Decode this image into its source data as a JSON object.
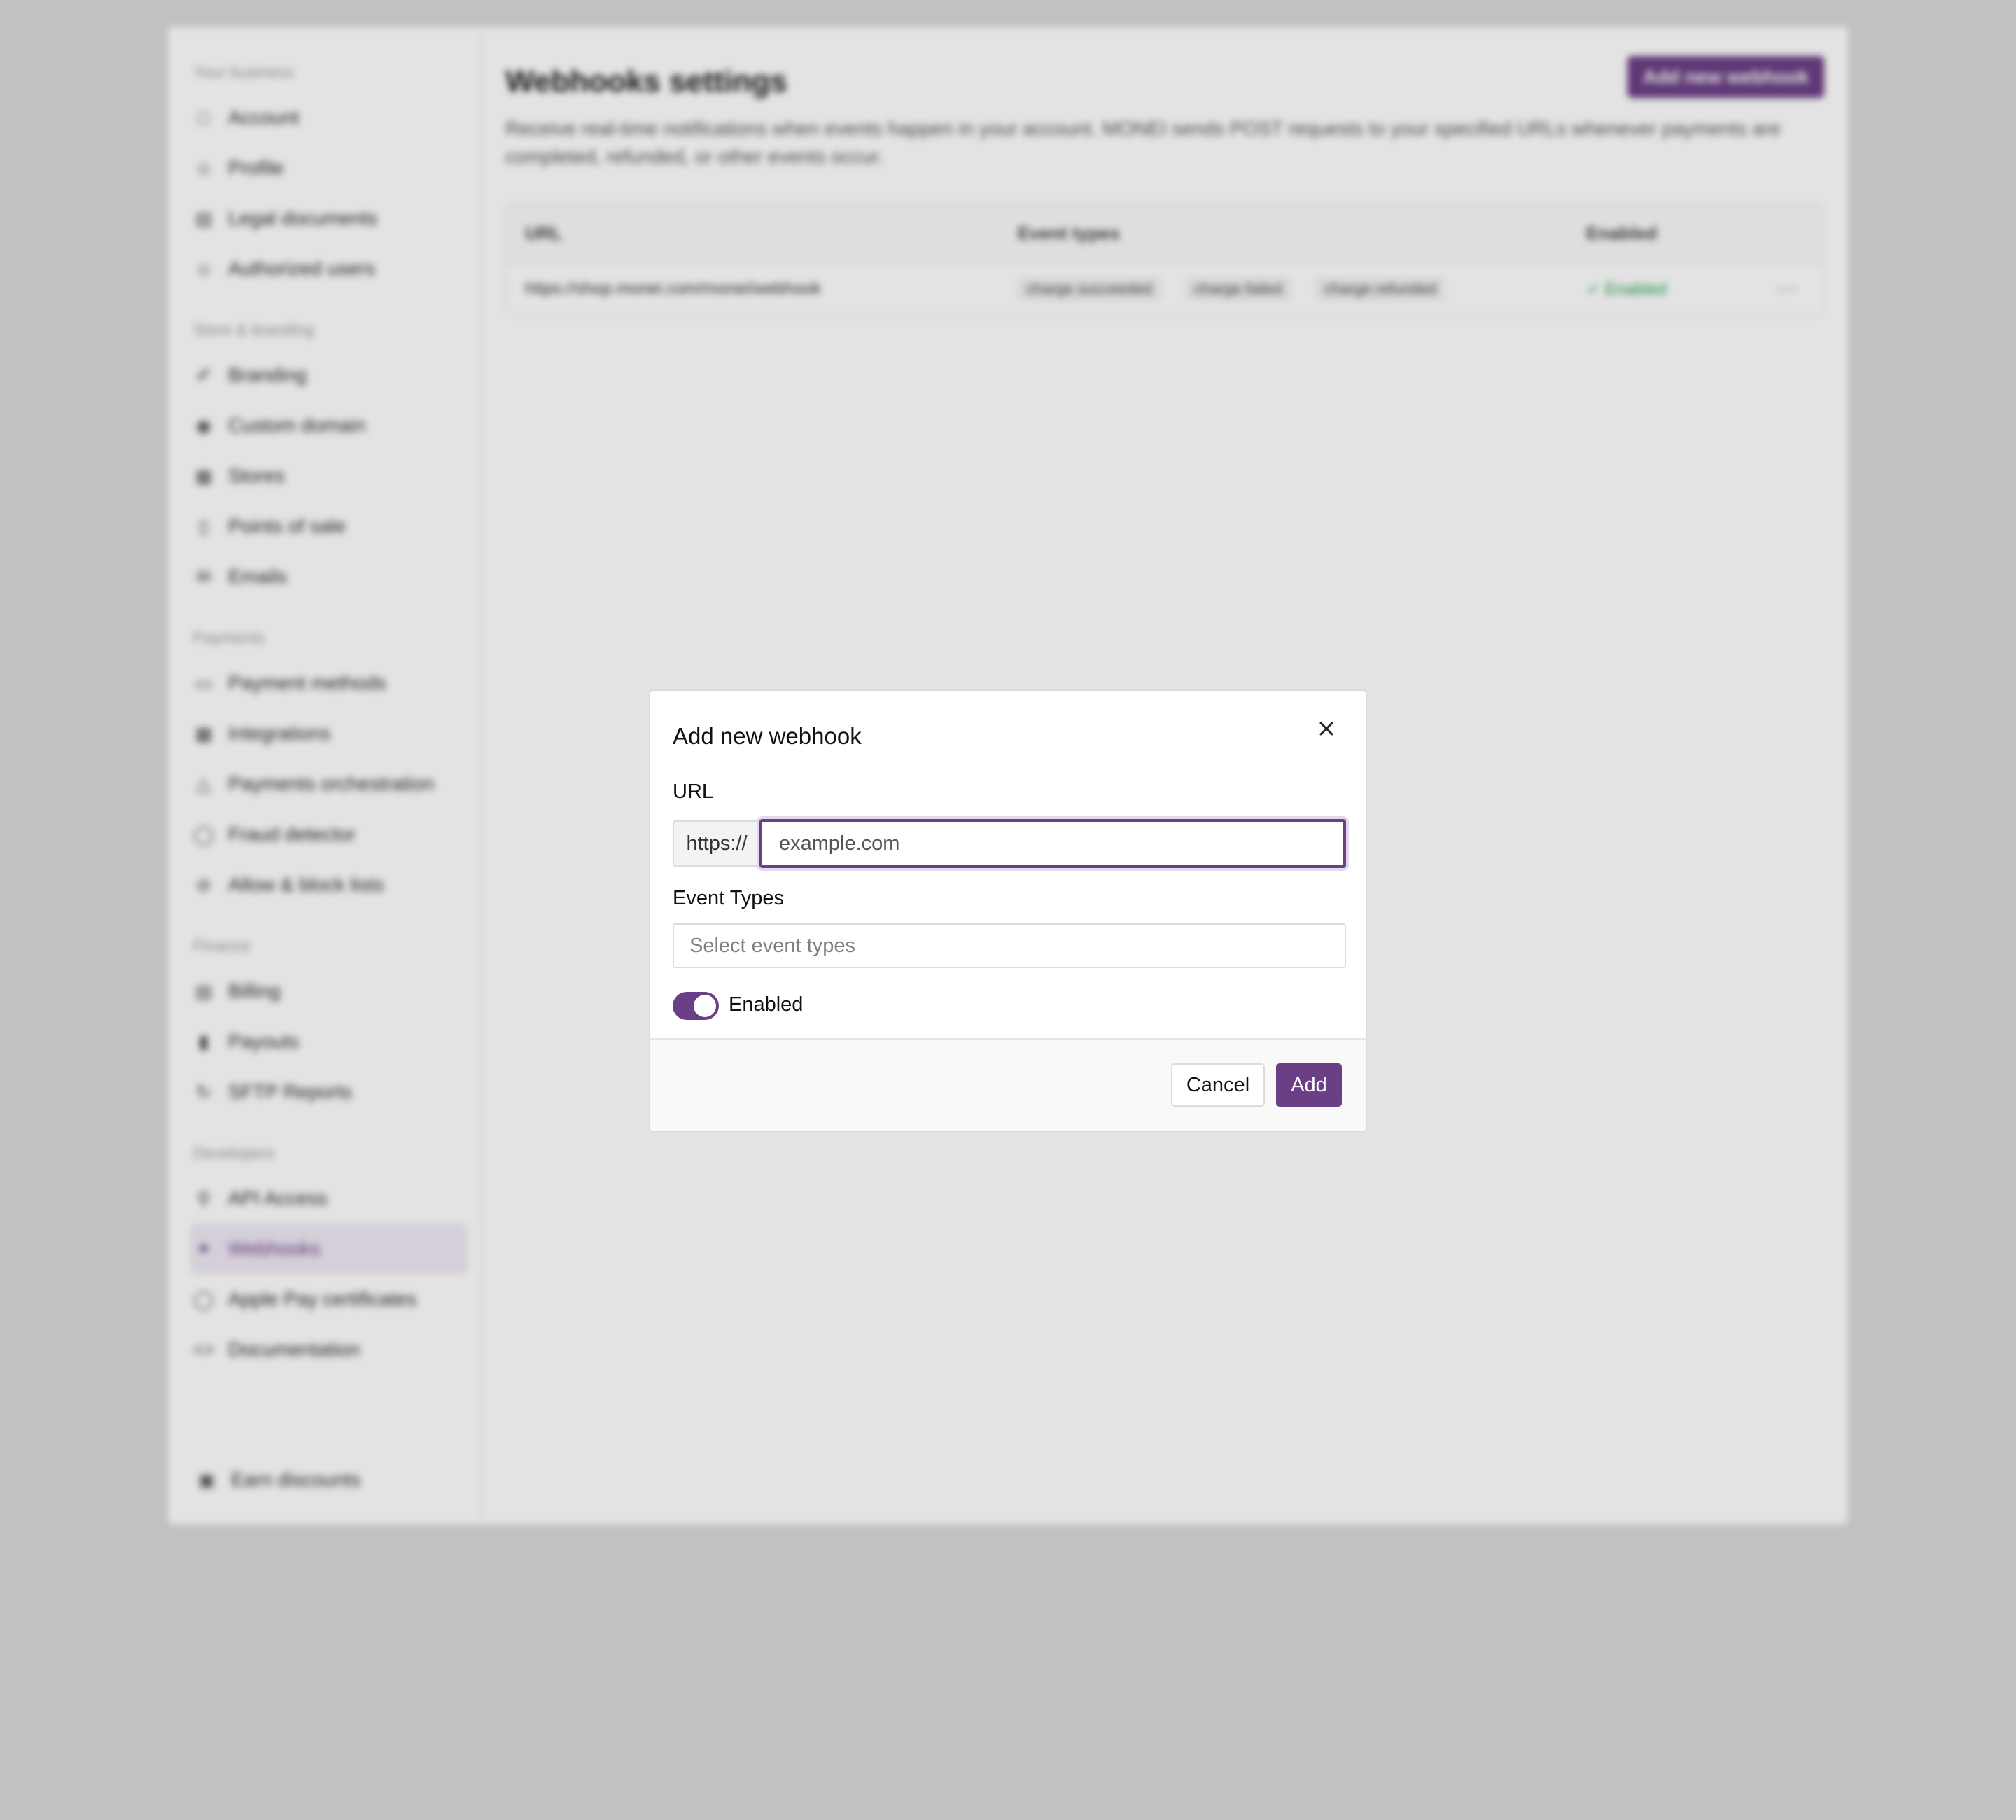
{
  "background": {
    "sidebar": {
      "sections": [
        {
          "heading": "Your business",
          "items": [
            {
              "label": "Account",
              "icon": "building-icon"
            },
            {
              "label": "Profile",
              "icon": "user-icon"
            },
            {
              "label": "Legal documents",
              "icon": "document-icon"
            },
            {
              "label": "Authorized users",
              "icon": "users-icon"
            }
          ]
        },
        {
          "heading": "Store & branding",
          "items": [
            {
              "label": "Branding",
              "icon": "brush-icon"
            },
            {
              "label": "Custom domain",
              "icon": "globe-icon"
            },
            {
              "label": "Stores",
              "icon": "store-icon"
            },
            {
              "label": "Points of sale",
              "icon": "device-icon"
            },
            {
              "label": "Emails",
              "icon": "mail-icon"
            }
          ]
        },
        {
          "heading": "Payments",
          "items": [
            {
              "label": "Payment methods",
              "icon": "card-icon"
            },
            {
              "label": "Integrations",
              "icon": "puzzle-icon"
            },
            {
              "label": "Payments orchestration",
              "icon": "route-icon"
            },
            {
              "label": "Fraud detector",
              "icon": "shield-icon"
            },
            {
              "label": "Allow & block lists",
              "icon": "list-icon"
            }
          ]
        },
        {
          "heading": "Finance",
          "items": [
            {
              "label": "Billing",
              "icon": "receipt-icon"
            },
            {
              "label": "Payouts",
              "icon": "payout-icon"
            },
            {
              "label": "SFTP Reports",
              "icon": "report-icon"
            }
          ]
        },
        {
          "heading": "Developers",
          "items": [
            {
              "label": "API Access",
              "icon": "key-icon"
            },
            {
              "label": "Webhooks",
              "icon": "webhook-icon"
            },
            {
              "label": "Apple Pay certificates",
              "icon": "apple-icon"
            },
            {
              "label": "Documentation",
              "icon": "code-icon"
            }
          ]
        }
      ],
      "active_item": "Webhooks",
      "bottom_item": {
        "label": "Earn discounts",
        "icon": "gift-icon"
      }
    },
    "main": {
      "title": "Webhooks settings",
      "add_button": "Add new webhook",
      "description": "Receive real-time notifications when events happen in your account. MONEI sends POST requests to your specified URLs whenever payments are completed, refunded, or other events occur.",
      "table": {
        "headers": [
          "URL",
          "Event types",
          "Enabled"
        ],
        "rows": [
          {
            "url": "https://shop.monei.com/monei/webhook",
            "events": [
              "charge.succeeded",
              "charge.failed",
              "charge.refunded"
            ],
            "enabled": "Enabled"
          }
        ]
      }
    }
  },
  "modal": {
    "title": "Add new webhook",
    "url_label": "URL",
    "url_prefix": "https://",
    "url_placeholder": "example.com",
    "event_types_label": "Event Types",
    "event_types_placeholder": "Select event types",
    "enabled_toggle": {
      "label": "Enabled",
      "checked": true
    },
    "cancel_label": "Cancel",
    "add_label": "Add"
  },
  "colors": {
    "accent": "#6b3f85",
    "accent_focus_ring": "#e4d9ec",
    "success": "#1e9c4b",
    "overlay": "rgba(0,0,0,0.11)"
  }
}
